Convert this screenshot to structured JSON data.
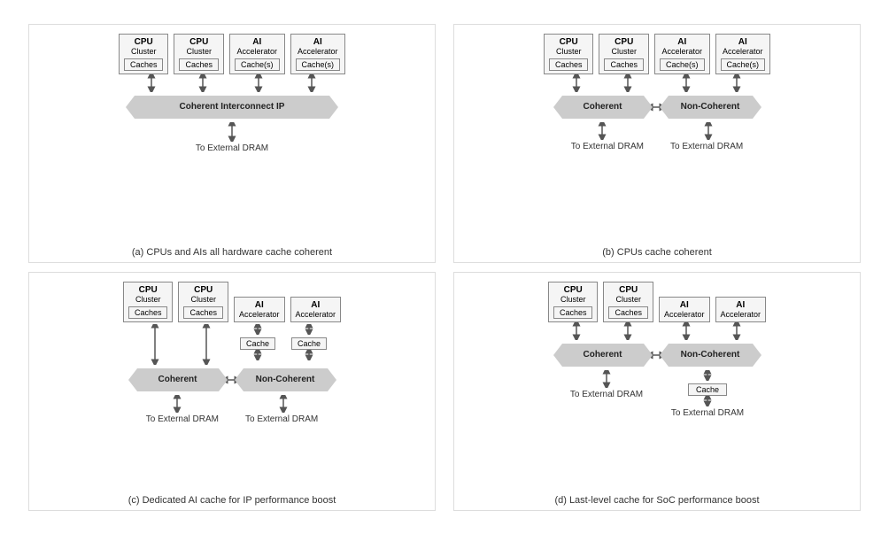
{
  "diagrams": [
    {
      "id": "a",
      "caption": "(a) CPUs and AIs all hardware cache coherent",
      "nodes": [
        {
          "type": "CPU",
          "sub": "Cluster",
          "cache": "Caches"
        },
        {
          "type": "CPU",
          "sub": "Cluster",
          "cache": "Caches"
        },
        {
          "type": "AI",
          "sub": "Accelerator",
          "cache": "Cache(s)"
        },
        {
          "type": "AI",
          "sub": "Accelerator",
          "cache": "Cache(s)"
        }
      ],
      "interconnect": "Coherent Interconnect IP",
      "dram": [
        "To External DRAM"
      ]
    },
    {
      "id": "b",
      "caption": "(b) CPUs cache coherent",
      "left_nodes": [
        {
          "type": "CPU",
          "sub": "Cluster",
          "cache": "Caches"
        },
        {
          "type": "CPU",
          "sub": "Cluster",
          "cache": "Caches"
        }
      ],
      "right_nodes": [
        {
          "type": "AI",
          "sub": "Accelerator",
          "cache": "Cache(s)"
        },
        {
          "type": "AI",
          "sub": "Accelerator",
          "cache": "Cache(s)"
        }
      ],
      "left_ribbon": "Coherent",
      "right_ribbon": "Non-Coherent",
      "dram": [
        "To External DRAM",
        "To External DRAM"
      ]
    },
    {
      "id": "c",
      "caption": "(c) Dedicated AI cache for IP performance boost",
      "left_nodes": [
        {
          "type": "CPU",
          "sub": "Cluster",
          "cache": "Caches"
        },
        {
          "type": "CPU",
          "sub": "Cluster",
          "cache": "Caches"
        }
      ],
      "right_nodes": [
        {
          "type": "AI",
          "sub": "Accelerator",
          "cache": null
        },
        {
          "type": "AI",
          "sub": "Accelerator",
          "cache": null
        }
      ],
      "ai_cache": "Cache",
      "left_ribbon": "Coherent",
      "right_ribbon": "Non-Coherent",
      "dram": [
        "To External DRAM",
        "To External DRAM"
      ]
    },
    {
      "id": "d",
      "caption": "(d) Last-level cache for SoC performance boost",
      "left_nodes": [
        {
          "type": "CPU",
          "sub": "Cluster",
          "cache": "Caches"
        },
        {
          "type": "CPU",
          "sub": "Cluster",
          "cache": "Caches"
        }
      ],
      "right_nodes": [
        {
          "type": "AI",
          "sub": "Accelerator",
          "cache": null
        },
        {
          "type": "AI",
          "sub": "Accelerator",
          "cache": null
        }
      ],
      "below_right_ribbon_cache": "Cache",
      "left_ribbon": "Coherent",
      "right_ribbon": "Non-Coherent",
      "dram": [
        "To External DRAM",
        "To External DRAM"
      ]
    }
  ]
}
